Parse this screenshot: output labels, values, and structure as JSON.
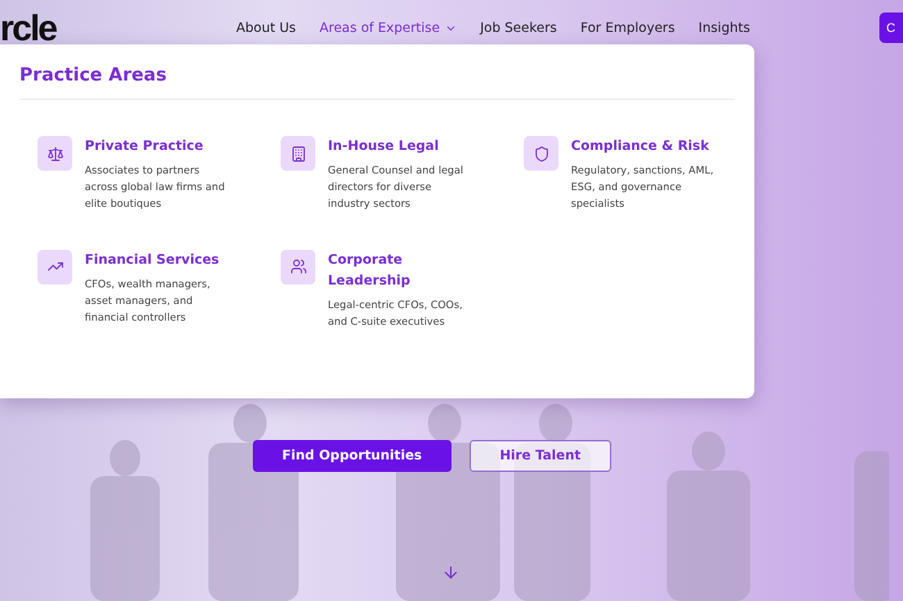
{
  "header": {
    "logo": "rcle",
    "nav": [
      {
        "label": "About Us",
        "selected": false,
        "has_menu": false
      },
      {
        "label": "Areas of Expertise",
        "selected": true,
        "has_menu": true
      },
      {
        "label": "Job Seekers",
        "selected": false,
        "has_menu": false
      },
      {
        "label": "For Employers",
        "selected": false,
        "has_menu": false
      },
      {
        "label": "Insights",
        "selected": false,
        "has_menu": false
      }
    ],
    "cta": "C"
  },
  "dropdown": {
    "title": "Practice Areas",
    "items": [
      {
        "title": "Private Practice",
        "description": "Associates to partners across global law firms and elite boutiques"
      },
      {
        "title": "In-House Legal",
        "description": "General Counsel and legal directors for diverse industry sectors"
      },
      {
        "title": "Compliance & Risk",
        "description": "Regulatory, sanctions, AML, ESG, and governance specialists"
      },
      {
        "title": "Financial Services",
        "description": "CFOs, wealth managers, asset managers, and financial controllers"
      },
      {
        "title": "Corporate Leadership",
        "description": "Legal-centric CFOs, COOs, and C-suite executives"
      }
    ]
  },
  "hero": {
    "buttons": [
      {
        "label": "Find Opportunities",
        "kind": "primary"
      },
      {
        "label": "Hire Talent",
        "kind": "outline"
      }
    ]
  }
}
